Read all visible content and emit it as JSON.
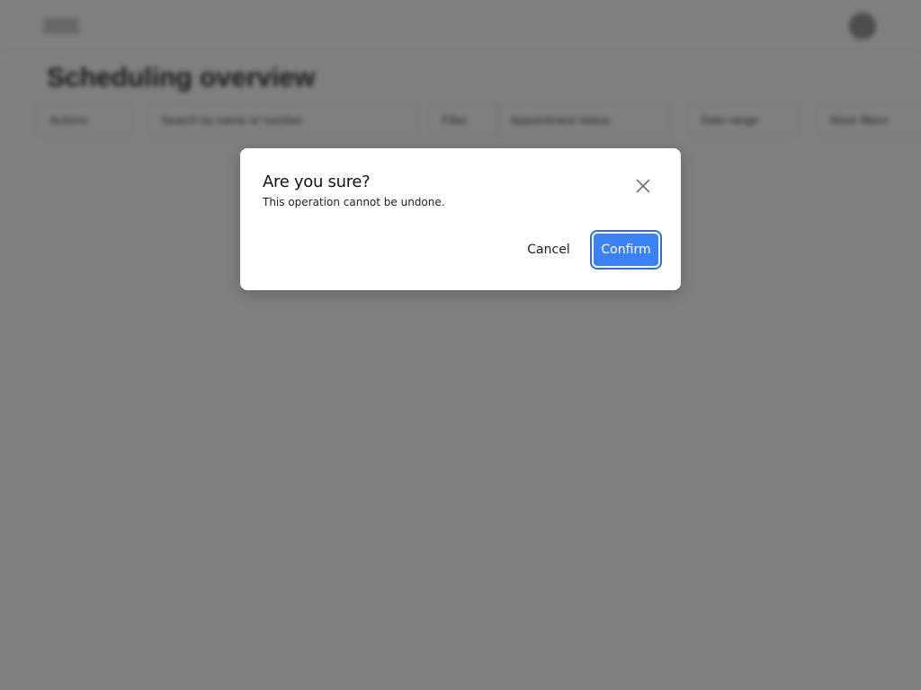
{
  "background": {
    "page_title": "Scheduling overview",
    "toolbar_items": [
      "Actions",
      "Search by name or number",
      "Filter",
      "Appointment status",
      "Date range",
      "More filters"
    ]
  },
  "dialog": {
    "title": "Are you sure?",
    "message": "This operation cannot be undone.",
    "close_icon": "close-icon",
    "cancel_label": "Cancel",
    "confirm_label": "Confirm"
  },
  "colors": {
    "overlay": "#808080",
    "confirm_button": "#3b82f6",
    "dialog_background": "#ffffff"
  }
}
